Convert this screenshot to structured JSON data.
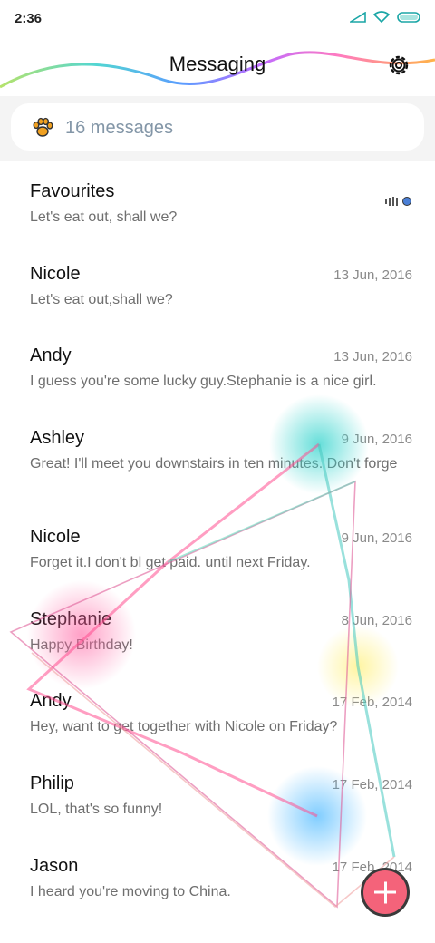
{
  "status_bar": {
    "time": "2:36"
  },
  "header": {
    "title": "Messaging"
  },
  "search": {
    "label": "16 messages"
  },
  "conversations": [
    {
      "name": "Favourites",
      "date": "",
      "preview": "Let's eat out, shall we?"
    },
    {
      "name": "Nicole",
      "date": "13 Jun, 2016",
      "preview": "Let's eat out,shall we?"
    },
    {
      "name": "Andy",
      "date": "13 Jun, 2016",
      "preview": "I guess you're some lucky guy.Stephanie is a nice girl."
    },
    {
      "name": "Ashley",
      "date": "9 Jun, 2016",
      "preview": "Great! I'll meet you downstairs in ten minutes. Don't forge"
    },
    {
      "name": "Nicole",
      "date": "9 Jun, 2016",
      "preview": "Forget it.I don't bl get paid. until next Friday."
    },
    {
      "name": "Stephanie",
      "date": "8 Jun, 2016",
      "preview": "Happy Birthday!"
    },
    {
      "name": "Andy",
      "date": "17 Feb, 2014",
      "preview": "Hey, want to get together with Nicole on Friday?"
    },
    {
      "name": "Philip",
      "date": "17 Feb, 2014",
      "preview": "LOL, that's so funny!"
    },
    {
      "name": "Jason",
      "date": "17 Feb, 2014",
      "preview": "I heard you're moving to China."
    }
  ],
  "colors": {
    "accent": "#f4637a",
    "search_text": "#8396a7"
  },
  "icons": [
    "signal-icon",
    "wifi-icon",
    "battery-icon",
    "settings-gear-icon",
    "paw-icon",
    "audio-wave-icon",
    "plus-icon"
  ]
}
